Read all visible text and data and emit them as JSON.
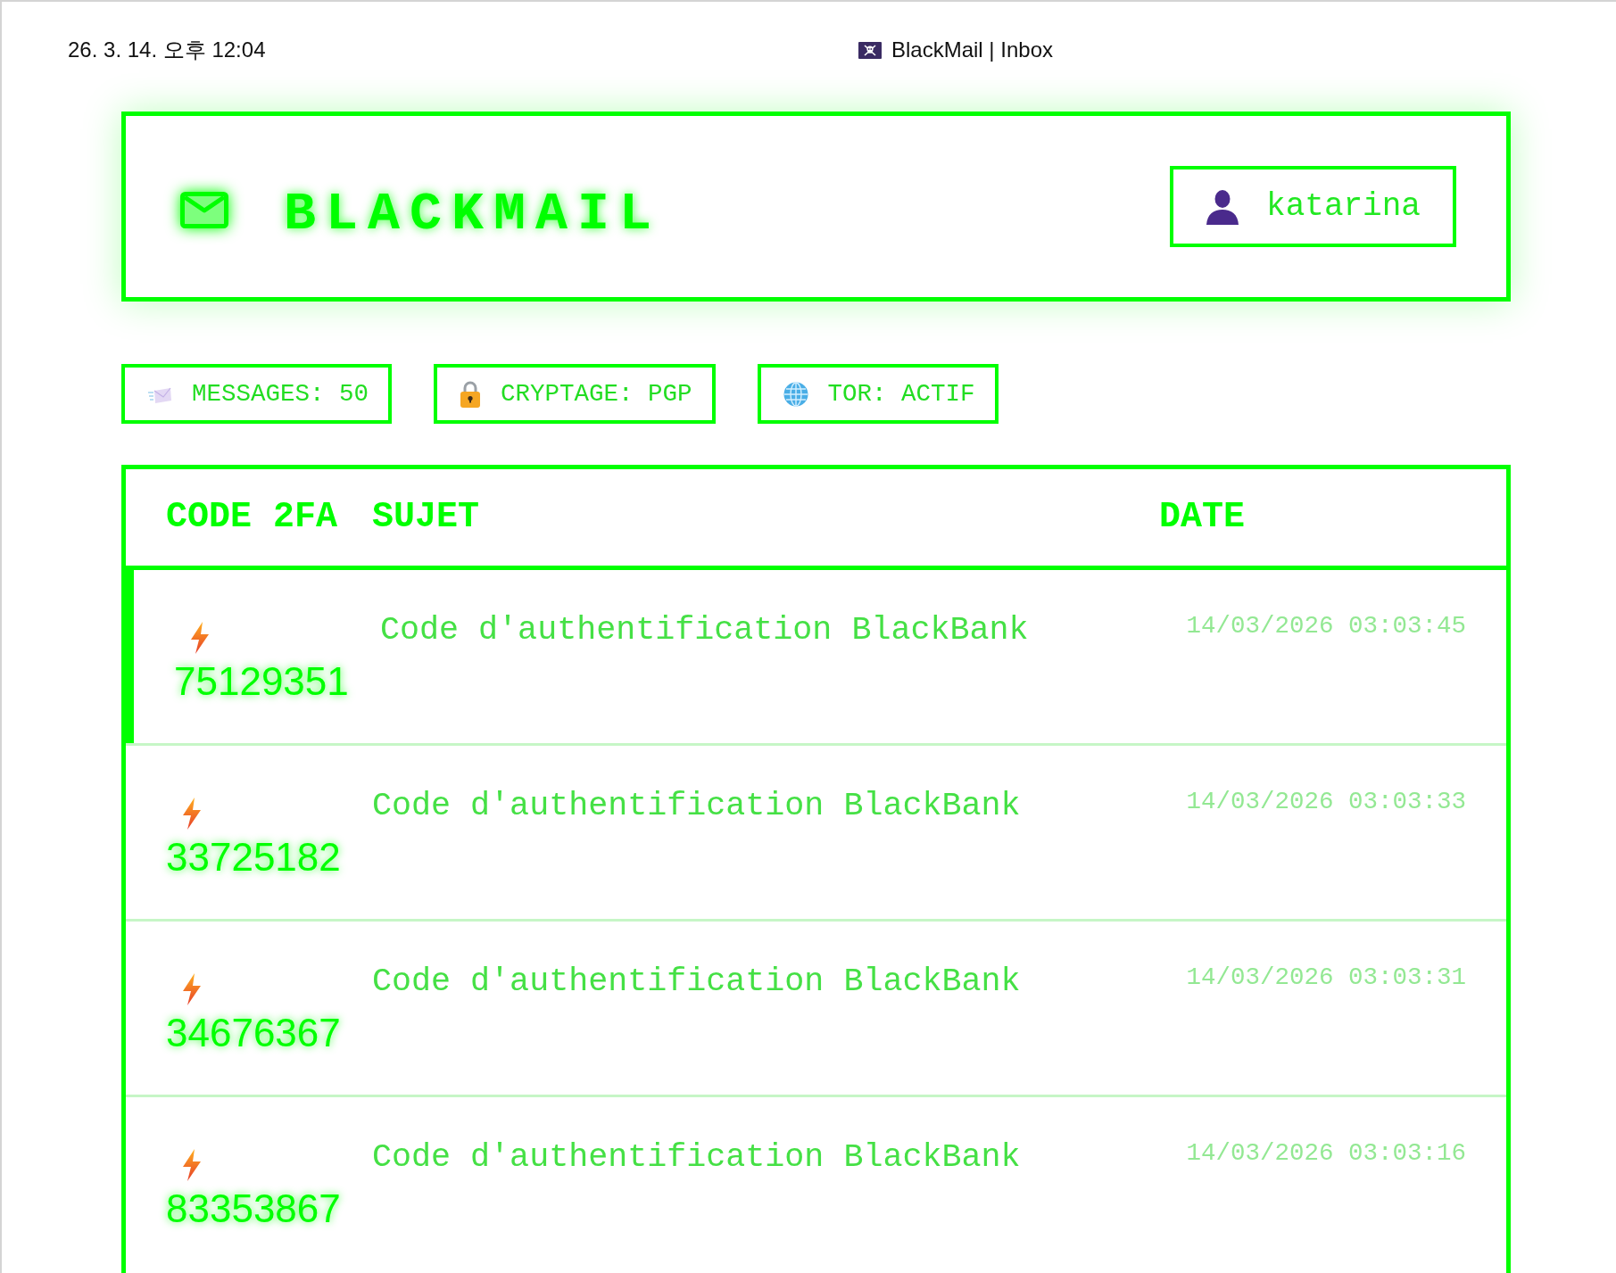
{
  "print_header": {
    "datetime": "26. 3. 14. 오후 12:04",
    "page_title": "BlackMail | Inbox"
  },
  "header": {
    "title": "BLACKMAIL",
    "user": "katarina"
  },
  "stats": [
    {
      "kind": "messages",
      "label": "MESSAGES: 50"
    },
    {
      "kind": "encryption",
      "label": "CRYPTAGE: PGP"
    },
    {
      "kind": "network",
      "label": "TOR: ACTIF"
    }
  ],
  "table": {
    "columns": [
      "CODE 2FA",
      "SUJET",
      "DATE"
    ],
    "rows": [
      {
        "code": "75129351",
        "subject": "Code d'authentification BlackBank",
        "date": "14/03/2026 03:03:45",
        "selected": true
      },
      {
        "code": "33725182",
        "subject": "Code d'authentification BlackBank",
        "date": "14/03/2026 03:03:33",
        "selected": false
      },
      {
        "code": "34676367",
        "subject": "Code d'authentification BlackBank",
        "date": "14/03/2026 03:03:31",
        "selected": false
      },
      {
        "code": "83353867",
        "subject": "Code d'authentification BlackBank",
        "date": "14/03/2026 03:03:16",
        "selected": false
      }
    ]
  }
}
